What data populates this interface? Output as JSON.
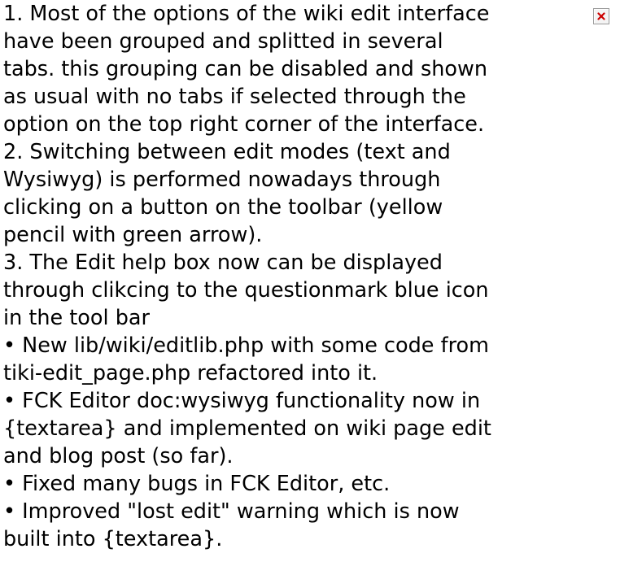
{
  "lines": [
    "1. Most of the options of the wiki edit interface",
    "have been grouped and splitted in several",
    "tabs. this grouping can be disabled and shown",
    "as usual with no tabs if selected through the",
    "option on the top right corner of the interface.",
    "2. Switching between edit modes (text and",
    "Wysiwyg) is performed nowadays through",
    "clicking on a button on the toolbar (yellow",
    "pencil with green arrow).",
    "3. The Edit help box now can be displayed",
    "through clikcing to the questionmark blue icon",
    "in the tool bar",
    "• New lib/wiki/editlib.php with some code from",
    "tiki-edit_page.php refactored into it.",
    "• FCK Editor doc:wysiwyg functionality now in",
    "{textarea} and implemented on wiki page edit",
    "and blog post (so far).",
    "• Fixed many bugs in FCK Editor, etc.",
    "• Improved \"lost edit\" warning which is now",
    "built into {textarea}."
  ],
  "image": {
    "icon": "broken-image-icon",
    "cross_color": "#cc0000"
  }
}
